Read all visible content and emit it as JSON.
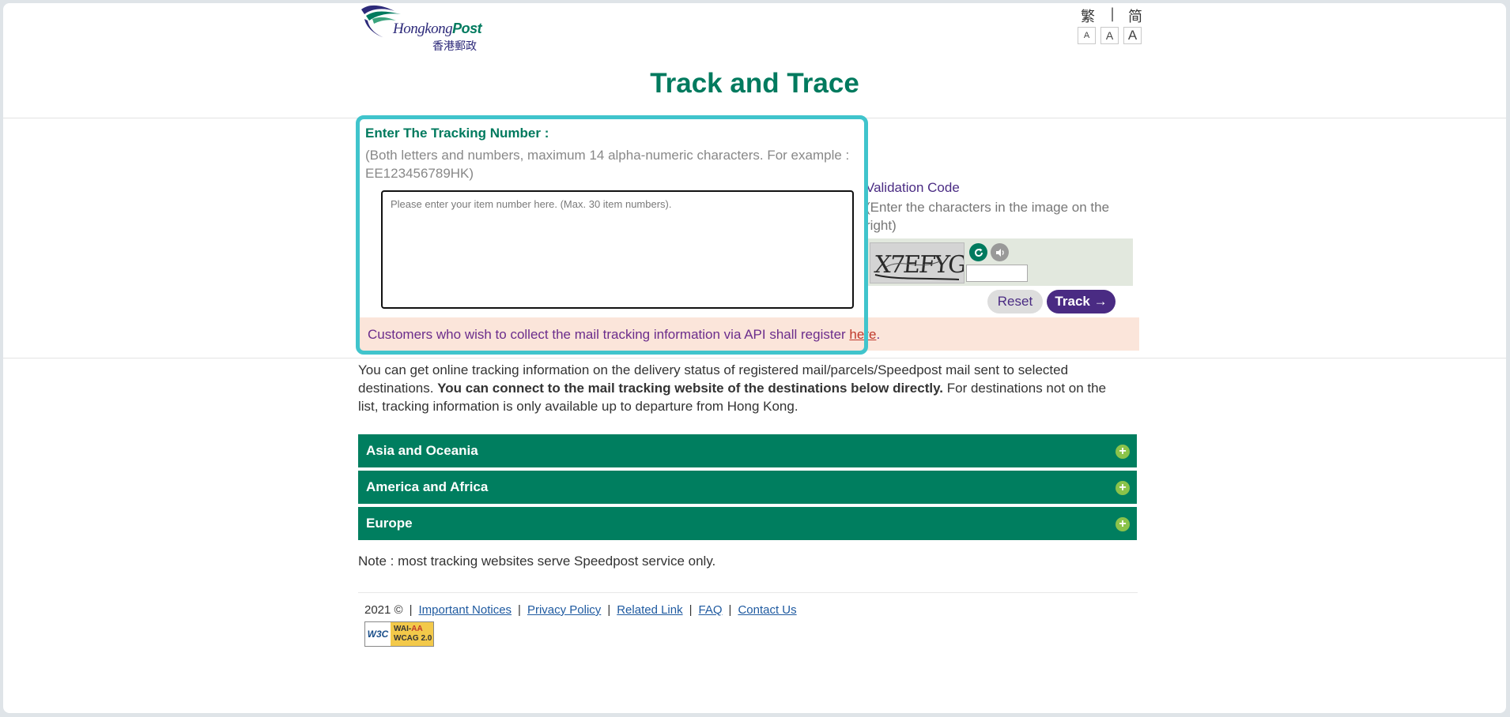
{
  "header": {
    "logo": {
      "en_left": "Hongkong",
      "en_right": "Post",
      "zh": "香港郵政"
    },
    "lang": {
      "traditional": "繁",
      "separator": "|",
      "simplified": "简"
    },
    "font_sizes": [
      "A",
      "A",
      "A"
    ]
  },
  "page_title": "Track and Trace",
  "tracking": {
    "label": "Enter The Tracking Number :",
    "hint": "(Both letters and numbers, maximum 14 alpha-numeric characters. For example : EE123456789HK)",
    "placeholder": "Please enter your item number here. (Max. 30 item numbers).",
    "value": ""
  },
  "api_notice": {
    "text": "Customers who wish to collect the mail tracking information via API shall register ",
    "link": "here",
    "end": "."
  },
  "validation": {
    "title": "Validation Code",
    "hint": "(Enter the characters in the image on the right)",
    "captcha_text": "X7EFYG",
    "refresh_icon": "refresh-icon",
    "audio_icon": "speaker-icon",
    "value": ""
  },
  "buttons": {
    "reset": "Reset",
    "track": "Track →"
  },
  "intro": {
    "part1": "You can get online tracking information on the delivery status of registered mail/parcels/Speedpost mail sent to selected destinations. ",
    "bold": "You can connect to the mail tracking website of the destinations below directly.",
    "part2": " For destinations not on the list, tracking information is only available up to departure from Hong Kong."
  },
  "regions": [
    {
      "label": "Asia and Oceania",
      "icon": "plus-icon"
    },
    {
      "label": "America and Africa",
      "icon": "plus-icon"
    },
    {
      "label": "Europe",
      "icon": "plus-icon"
    }
  ],
  "note": "Note : most tracking websites serve Speedpost service only.",
  "footer": {
    "copyright": "2021 ©",
    "links": [
      "Important Notices",
      "Privacy Policy",
      "Related Link",
      "FAQ",
      "Contact Us"
    ],
    "badge": {
      "left": "W3C",
      "line1_a": "WAI-",
      "line1_b": "AA",
      "line2": "WCAG 2.0"
    }
  },
  "colors": {
    "brand_green": "#007a5e",
    "brand_purple": "#4a2b83",
    "focus_ring": "#40c4cc",
    "notice_bg": "#fbe5da"
  }
}
